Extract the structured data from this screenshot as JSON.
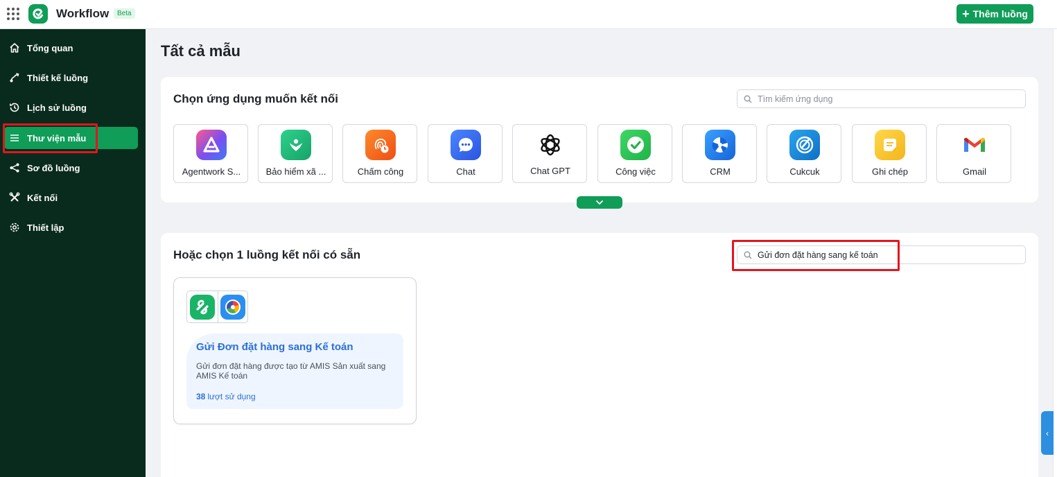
{
  "header": {
    "app_title": "Workflow",
    "badge": "Beta",
    "add_button": "Thêm luồng"
  },
  "sidebar": {
    "items": [
      {
        "label": "Tổng quan",
        "icon": "home-icon"
      },
      {
        "label": "Thiết kế luồng",
        "icon": "flow-design-icon"
      },
      {
        "label": "Lịch sử luồng",
        "icon": "history-icon"
      },
      {
        "label": "Thư viện mẫu",
        "icon": "menu-lines-icon",
        "active": true
      },
      {
        "label": "Sơ đồ luồng",
        "icon": "share-nodes-icon"
      },
      {
        "label": "Kết nối",
        "icon": "tools-icon"
      },
      {
        "label": "Thiết lập",
        "icon": "gear-icon"
      }
    ]
  },
  "main": {
    "page_title": "Tất cả mẫu",
    "apps_section": {
      "title": "Chọn ứng dụng muốn kết nối",
      "search_placeholder": "Tìm kiếm ứng dụng",
      "apps": [
        {
          "name": "Agentwork S...",
          "color": "#7b4ef0"
        },
        {
          "name": "Bảo hiểm xã ...",
          "color": "#22b573"
        },
        {
          "name": "Chấm công",
          "color": "#f26a1b"
        },
        {
          "name": "Chat",
          "color": "#3b6ff5"
        },
        {
          "name": "Chat GPT",
          "color": "#000000"
        },
        {
          "name": "Công việc",
          "color": "#2ec44f"
        },
        {
          "name": "CRM",
          "color": "#1e7fe6"
        },
        {
          "name": "Cukcuk",
          "color": "#1a86d9"
        },
        {
          "name": "Ghi chép",
          "color": "#f7c531"
        },
        {
          "name": "Gmail",
          "color": "#ea4335"
        }
      ]
    },
    "flows_section": {
      "title": "Hoặc chọn 1 luồng kết nối có sẵn",
      "search_value": "Gửi đơn đặt hàng sang kế toán",
      "flows": [
        {
          "name": "Gửi Đơn đặt hàng sang Kế toán",
          "description": "Gửi đơn đặt hàng được tạo từ AMIS Sản xuất sang AMIS Kế toán",
          "usage_count": "38",
          "usage_label": "lượt sử dụng"
        }
      ]
    }
  },
  "colors": {
    "brand": "#0f9d58",
    "sidebar_bg": "#092b1d",
    "highlight": "#e5141e",
    "link": "#2c6fd6"
  }
}
